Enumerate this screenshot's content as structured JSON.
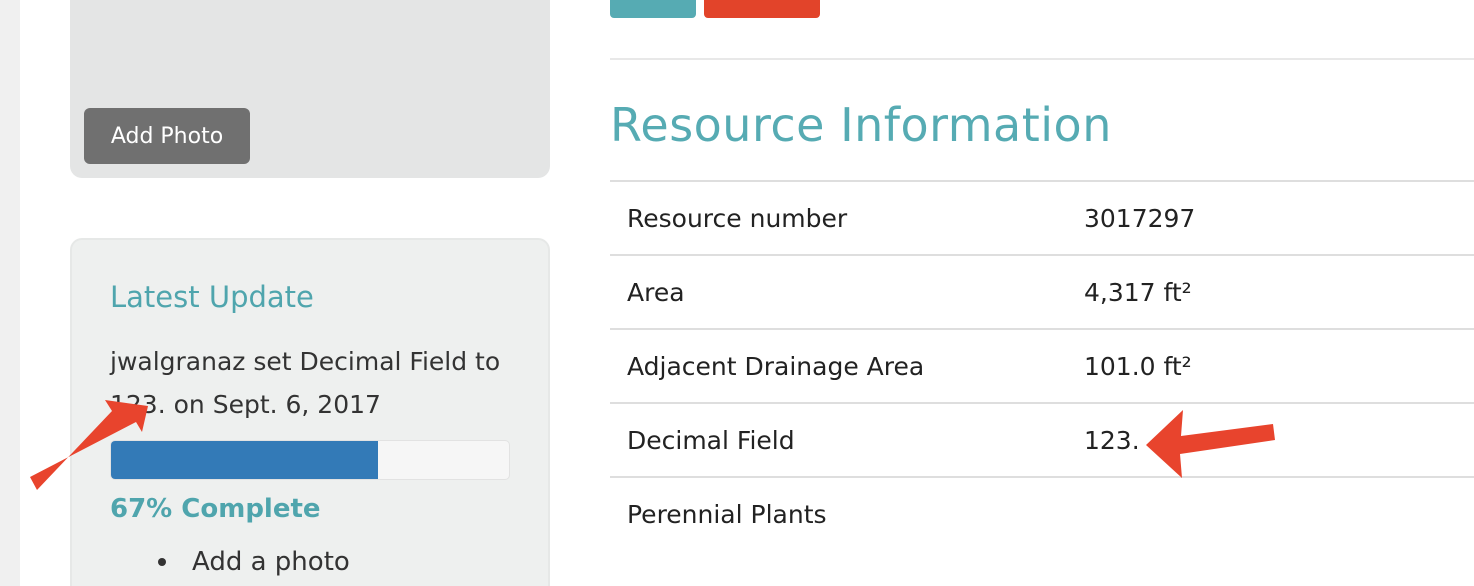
{
  "photo_panel": {
    "add_photo_label": "Add Photo"
  },
  "latest_update": {
    "title": "Latest Update",
    "text": "jwalgranaz set Decimal Field to 123. on Sept. 6, 2017",
    "progress_percent": 67,
    "progress_label": "67% Complete",
    "todo_items": [
      "Add a photo"
    ]
  },
  "top_buttons": {
    "colors": [
      "#56abb3",
      "#e2442a"
    ]
  },
  "resource_info": {
    "title": "Resource Information",
    "rows": [
      {
        "label": "Resource number",
        "value": "3017297"
      },
      {
        "label": "Area",
        "value": "4,317 ft²"
      },
      {
        "label": "Adjacent Drainage Area",
        "value": "101.0 ft²"
      },
      {
        "label": "Decimal Field",
        "value": "123."
      },
      {
        "label": "Perennial Plants",
        "value": ""
      }
    ]
  },
  "annotations": {
    "arrow_color": "#e8442d"
  },
  "colors": {
    "accent": "#56abb3",
    "progress": "#337ab7",
    "danger": "#e2442a"
  }
}
